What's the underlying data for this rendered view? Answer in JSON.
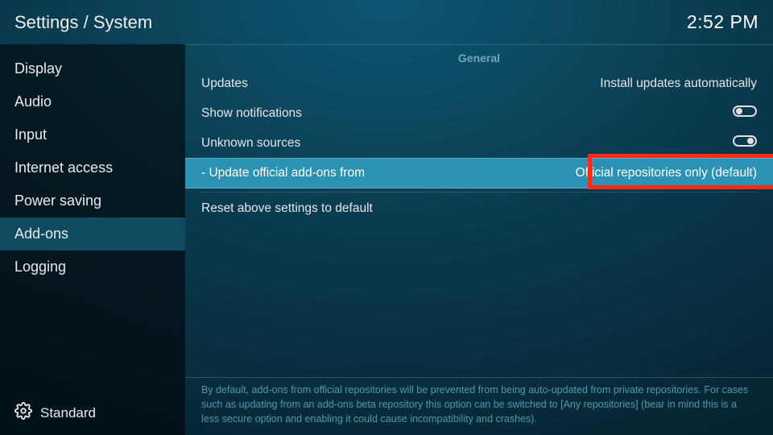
{
  "header": {
    "breadcrumb": "Settings / System",
    "clock": "2:52 PM"
  },
  "sidebar": {
    "items": [
      {
        "label": "Display",
        "selected": false
      },
      {
        "label": "Audio",
        "selected": false
      },
      {
        "label": "Input",
        "selected": false
      },
      {
        "label": "Internet access",
        "selected": false
      },
      {
        "label": "Power saving",
        "selected": false
      },
      {
        "label": "Add-ons",
        "selected": true
      },
      {
        "label": "Logging",
        "selected": false
      }
    ],
    "level_label": "Standard"
  },
  "content": {
    "section_title": "General",
    "rows": [
      {
        "label": "Updates",
        "value": "Install updates automatically",
        "type": "text",
        "highlighted": false
      },
      {
        "label": "Show notifications",
        "value": "off",
        "type": "toggle",
        "highlighted": false
      },
      {
        "label": "Unknown sources",
        "value": "on",
        "type": "toggle",
        "highlighted": false
      },
      {
        "label": "- Update official add-ons from",
        "value": "Official repositories only (default)",
        "type": "text",
        "highlighted": true,
        "red_box": true
      },
      {
        "label": "Reset above settings to default",
        "value": "",
        "type": "action",
        "highlighted": false
      }
    ],
    "description": "By default, add-ons from official repositories will be prevented from being auto-updated from private repositories. For cases such as updating from an add-ons beta repository this option can be switched to [Any repositories] (bear in mind this is a less secure option and enabling it could cause incompatibility and crashes)."
  },
  "colors": {
    "highlight_row": "#2c92b4",
    "red_box": "#ff2a12",
    "teal_text": "#4f99ad"
  }
}
